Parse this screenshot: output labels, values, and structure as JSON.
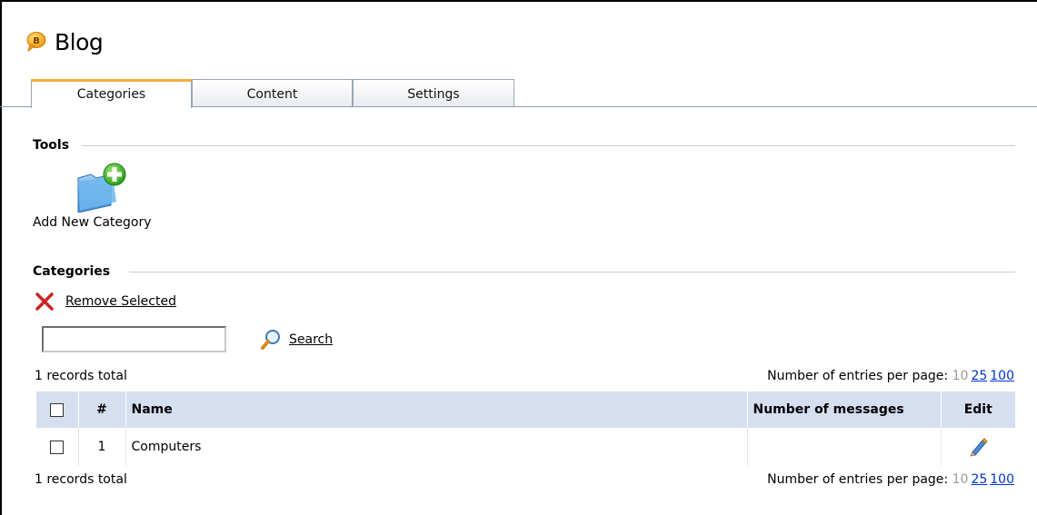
{
  "header": {
    "title": "Blog",
    "icon": "blog-icon"
  },
  "tabs": [
    {
      "label": "Categories",
      "active": true
    },
    {
      "label": "Content",
      "active": false
    },
    {
      "label": "Settings",
      "active": false
    }
  ],
  "tools": {
    "title": "Tools",
    "add_category": {
      "label": "Add New Category",
      "icon": "folder-add-icon"
    }
  },
  "categories": {
    "title": "Categories",
    "remove_selected": "Remove Selected",
    "search": {
      "value": "",
      "placeholder": "",
      "button_label": "Search"
    },
    "records_total_top": "1 records total",
    "records_total_bottom": "1 records total",
    "pager": {
      "label": "Number of entries per page:",
      "current": "10",
      "options": [
        "25",
        "100"
      ]
    },
    "table": {
      "columns": [
        "",
        "#",
        "Name",
        "Number of messages",
        "Edit"
      ],
      "rows": [
        {
          "num": "1",
          "name": "Computers",
          "messages": ""
        }
      ]
    }
  },
  "colors": {
    "tab_accent": "#f2ad3d",
    "header_bg": "#d6dff0",
    "link_blue": "#0033cc",
    "remove_red": "#cc2222"
  }
}
